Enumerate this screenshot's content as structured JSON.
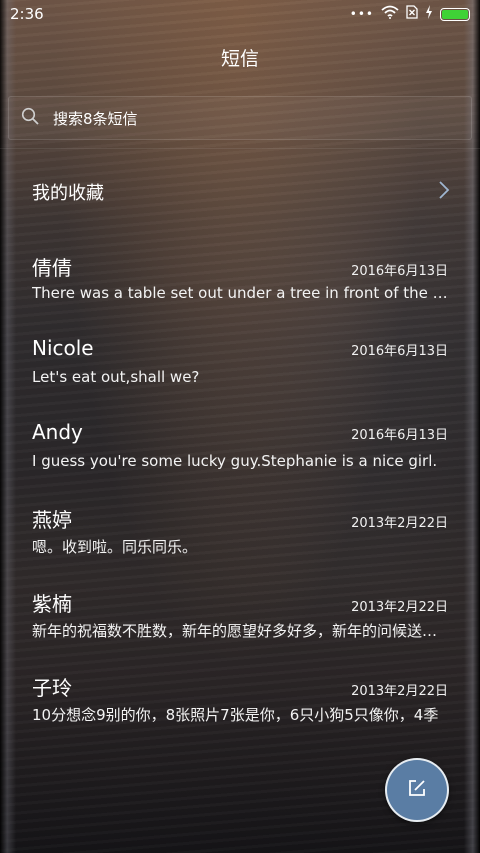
{
  "status_bar": {
    "time": "2:36",
    "dots": "•••",
    "icons": [
      "wifi-icon",
      "sim-blocked-icon",
      "charging-icon"
    ],
    "battery_color": "#3fd236"
  },
  "header": {
    "title": "短信"
  },
  "search": {
    "placeholder": "搜索8条短信"
  },
  "favorites": {
    "label": "我的收藏"
  },
  "conversations": [
    {
      "name": "倩倩",
      "date": "2016年6月13日",
      "preview": "There was a table set out under a tree in front of the house"
    },
    {
      "name": "Nicole",
      "date": "2016年6月13日",
      "preview": "Let's eat out,shall we?"
    },
    {
      "name": "Andy",
      "date": "2016年6月13日",
      "preview": "I guess you're some lucky guy.Stephanie is a nice girl."
    },
    {
      "name": "燕婷",
      "date": "2013年2月22日",
      "preview": "嗯。收到啦。同乐同乐。"
    },
    {
      "name": "紫楠",
      "date": "2013年2月22日",
      "preview": "新年的祝福数不胜数，新年的愿望好多好多，新年的问候送给你"
    },
    {
      "name": "子玲",
      "date": "2013年2月22日",
      "preview": "10分想念9别的你，8张照片7张是你，6只小狗5只像你，4季"
    }
  ],
  "fab": {
    "icon": "compose-icon",
    "color": "#5a7da4"
  }
}
